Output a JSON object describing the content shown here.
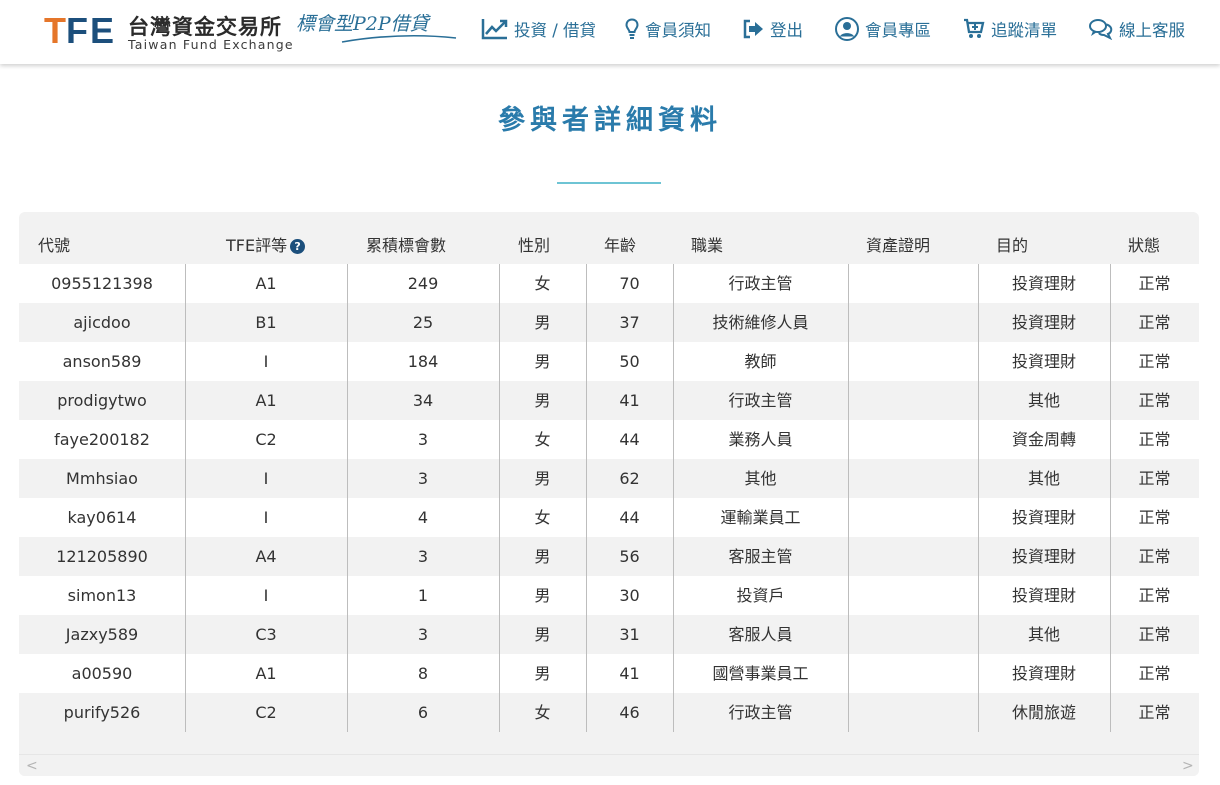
{
  "brand": {
    "chinese_name": "台灣資金交易所",
    "english_name": "Taiwan Fund Exchange",
    "tagline": "標會型P2P借貸",
    "logo_text": "TFE"
  },
  "nav": [
    {
      "label": "投資 / 借貸",
      "icon": "line-chart-icon"
    },
    {
      "label": "會員須知",
      "icon": "lightbulb-icon"
    },
    {
      "label": "登出",
      "icon": "sign-out-icon"
    },
    {
      "label": "會員專區",
      "icon": "user-circle-icon"
    },
    {
      "label": "追蹤清單",
      "icon": "cart-plus-icon"
    },
    {
      "label": "線上客服",
      "icon": "chat-bubbles-icon"
    }
  ],
  "page": {
    "title": "參與者詳細資料"
  },
  "table": {
    "headers": [
      "代號",
      "TFE評等",
      "累積標會數",
      "性別",
      "年齡",
      "職業",
      "資產證明",
      "目的",
      "狀態"
    ],
    "help_icon_label": "?",
    "rows": [
      [
        "0955121398",
        "A1",
        "249",
        "女",
        "70",
        "行政主管",
        "",
        "投資理財",
        "正常"
      ],
      [
        "ajicdoo",
        "B1",
        "25",
        "男",
        "37",
        "技術維修人員",
        "",
        "投資理財",
        "正常"
      ],
      [
        "anson589",
        "I",
        "184",
        "男",
        "50",
        "教師",
        "",
        "投資理財",
        "正常"
      ],
      [
        "prodigytwo",
        "A1",
        "34",
        "男",
        "41",
        "行政主管",
        "",
        "其他",
        "正常"
      ],
      [
        "faye200182",
        "C2",
        "3",
        "女",
        "44",
        "業務人員",
        "",
        "資金周轉",
        "正常"
      ],
      [
        "Mmhsiao",
        "I",
        "3",
        "男",
        "62",
        "其他",
        "",
        "其他",
        "正常"
      ],
      [
        "kay0614",
        "I",
        "4",
        "女",
        "44",
        "運輸業員工",
        "",
        "投資理財",
        "正常"
      ],
      [
        "121205890",
        "A4",
        "3",
        "男",
        "56",
        "客服主管",
        "",
        "投資理財",
        "正常"
      ],
      [
        "simon13",
        "I",
        "1",
        "男",
        "30",
        "投資戶",
        "",
        "投資理財",
        "正常"
      ],
      [
        "Jazxy589",
        "C3",
        "3",
        "男",
        "31",
        "客服人員",
        "",
        "其他",
        "正常"
      ],
      [
        "a00590",
        "A1",
        "8",
        "男",
        "41",
        "國營事業員工",
        "",
        "投資理財",
        "正常"
      ],
      [
        "purify526",
        "C2",
        "6",
        "女",
        "46",
        "行政主管",
        "",
        "休閒旅遊",
        "正常"
      ]
    ]
  },
  "scrollbar": {
    "left_arrow": "<",
    "right_arrow": ">"
  },
  "colors": {
    "accent": "#2a6f97",
    "title": "#2a7bab",
    "title_rule": "#6ec4d4",
    "logo_orange": "#e5762a",
    "logo_navy": "#1c4f7c"
  }
}
